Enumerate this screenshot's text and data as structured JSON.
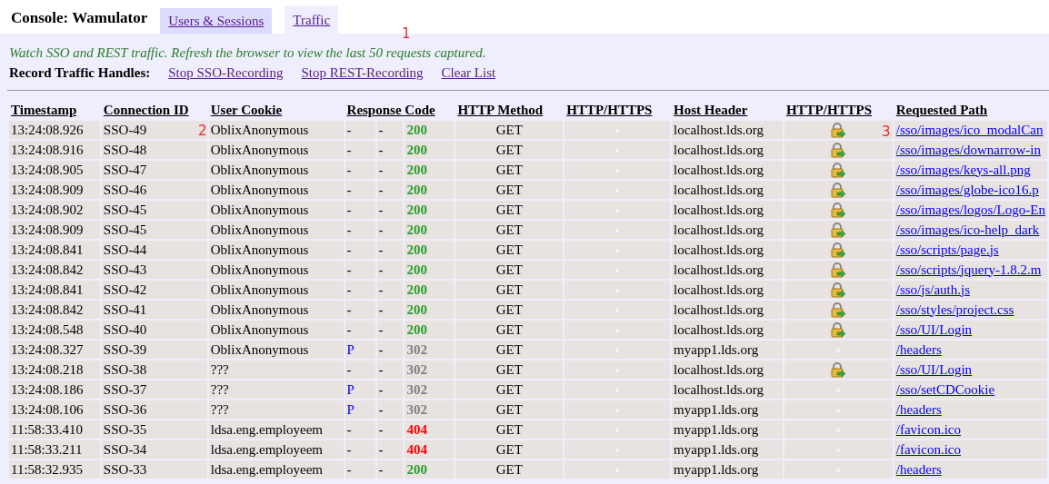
{
  "header": {
    "title": "Console: Wamulator",
    "tabs": [
      {
        "label": "Users & Sessions",
        "selected": false
      },
      {
        "label": "Traffic",
        "selected": true
      }
    ]
  },
  "intro": "Watch SSO and REST traffic. Refresh the browser to view the last 50 requests captured.",
  "record": {
    "label": "Record Traffic Handles:",
    "links": [
      "Stop SSO-Recording",
      "Stop REST-Recording",
      "Clear List"
    ]
  },
  "markers": [
    "1",
    "2",
    "3"
  ],
  "table": {
    "columns": [
      "Timestamp",
      "Connection ID",
      "User Cookie",
      "Response Code",
      "HTTP Method",
      "HTTP/HTTPS",
      "Host Header",
      "HTTP/HTTPS",
      "Requested Path"
    ],
    "rows": [
      {
        "timestamp": "13:24:08.926",
        "connection": "SSO-49",
        "cookie": "OblixAnonymous",
        "flag": "-",
        "flag_highlighted": false,
        "flag2": "-",
        "code": "200",
        "method": "GET",
        "host": "localhost.lds.org",
        "secure": true,
        "path": "/sso/images/ico_modalCan"
      },
      {
        "timestamp": "13:24:08.916",
        "connection": "SSO-48",
        "cookie": "OblixAnonymous",
        "flag": "-",
        "flag_highlighted": false,
        "flag2": "-",
        "code": "200",
        "method": "GET",
        "host": "localhost.lds.org",
        "secure": true,
        "path": "/sso/images/downarrow-in"
      },
      {
        "timestamp": "13:24:08.905",
        "connection": "SSO-47",
        "cookie": "OblixAnonymous",
        "flag": "-",
        "flag_highlighted": false,
        "flag2": "-",
        "code": "200",
        "method": "GET",
        "host": "localhost.lds.org",
        "secure": true,
        "path": "/sso/images/keys-all.png"
      },
      {
        "timestamp": "13:24:08.909",
        "connection": "SSO-46",
        "cookie": "OblixAnonymous",
        "flag": "-",
        "flag_highlighted": false,
        "flag2": "-",
        "code": "200",
        "method": "GET",
        "host": "localhost.lds.org",
        "secure": true,
        "path": "/sso/images/globe-ico16.p"
      },
      {
        "timestamp": "13:24:08.902",
        "connection": "SSO-45",
        "cookie": "OblixAnonymous",
        "flag": "-",
        "flag_highlighted": false,
        "flag2": "-",
        "code": "200",
        "method": "GET",
        "host": "localhost.lds.org",
        "secure": true,
        "path": "/sso/images/logos/Logo-En"
      },
      {
        "timestamp": "13:24:08.909",
        "connection": "SSO-45",
        "cookie": "OblixAnonymous",
        "flag": "-",
        "flag_highlighted": false,
        "flag2": "-",
        "code": "200",
        "method": "GET",
        "host": "localhost.lds.org",
        "secure": true,
        "path": "/sso/images/ico-help_dark"
      },
      {
        "timestamp": "13:24:08.841",
        "connection": "SSO-44",
        "cookie": "OblixAnonymous",
        "flag": "-",
        "flag_highlighted": false,
        "flag2": "-",
        "code": "200",
        "method": "GET",
        "host": "localhost.lds.org",
        "secure": true,
        "path": "/sso/scripts/page.js"
      },
      {
        "timestamp": "13:24:08.842",
        "connection": "SSO-43",
        "cookie": "OblixAnonymous",
        "flag": "-",
        "flag_highlighted": false,
        "flag2": "-",
        "code": "200",
        "method": "GET",
        "host": "localhost.lds.org",
        "secure": true,
        "path": "/sso/scripts/jquery-1.8.2.m"
      },
      {
        "timestamp": "13:24:08.841",
        "connection": "SSO-42",
        "cookie": "OblixAnonymous",
        "flag": "-",
        "flag_highlighted": false,
        "flag2": "-",
        "code": "200",
        "method": "GET",
        "host": "localhost.lds.org",
        "secure": true,
        "path": "/sso/js/auth.js"
      },
      {
        "timestamp": "13:24:08.842",
        "connection": "SSO-41",
        "cookie": "OblixAnonymous",
        "flag": "-",
        "flag_highlighted": false,
        "flag2": "-",
        "code": "200",
        "method": "GET",
        "host": "localhost.lds.org",
        "secure": true,
        "path": "/sso/styles/project.css"
      },
      {
        "timestamp": "13:24:08.548",
        "connection": "SSO-40",
        "cookie": "OblixAnonymous",
        "flag": "-",
        "flag_highlighted": false,
        "flag2": "-",
        "code": "200",
        "method": "GET",
        "host": "localhost.lds.org",
        "secure": true,
        "path": "/sso/UI/Login"
      },
      {
        "timestamp": "13:24:08.327",
        "connection": "SSO-39",
        "cookie": "OblixAnonymous",
        "flag": "P",
        "flag_highlighted": true,
        "flag2": "-",
        "code": "302",
        "method": "GET",
        "host": "myapp1.lds.org",
        "secure": false,
        "path": "/headers"
      },
      {
        "timestamp": "13:24:08.218",
        "connection": "SSO-38",
        "cookie": "???",
        "flag": "-",
        "flag_highlighted": false,
        "flag2": "-",
        "code": "302",
        "method": "GET",
        "host": "localhost.lds.org",
        "secure": true,
        "path": "/sso/UI/Login"
      },
      {
        "timestamp": "13:24:08.186",
        "connection": "SSO-37",
        "cookie": "???",
        "flag": "P",
        "flag_highlighted": true,
        "flag2": "-",
        "code": "302",
        "method": "GET",
        "host": "localhost.lds.org",
        "secure": false,
        "path": "/sso/setCDCookie"
      },
      {
        "timestamp": "13:24:08.106",
        "connection": "SSO-36",
        "cookie": "???",
        "flag": "P",
        "flag_highlighted": true,
        "flag2": "-",
        "code": "302",
        "method": "GET",
        "host": "myapp1.lds.org",
        "secure": false,
        "path": "/headers"
      },
      {
        "timestamp": "11:58:33.410",
        "connection": "SSO-35",
        "cookie": "ldsa.eng.employeem",
        "flag": "-",
        "flag_highlighted": false,
        "flag2": "-",
        "code": "404",
        "method": "GET",
        "host": "myapp1.lds.org",
        "secure": false,
        "path": "/favicon.ico"
      },
      {
        "timestamp": "11:58:33.211",
        "connection": "SSO-34",
        "cookie": "ldsa.eng.employeem",
        "flag": "-",
        "flag_highlighted": false,
        "flag2": "-",
        "code": "404",
        "method": "GET",
        "host": "myapp1.lds.org",
        "secure": false,
        "path": "/favicon.ico"
      },
      {
        "timestamp": "11:58:32.935",
        "connection": "SSO-33",
        "cookie": "ldsa.eng.employeem",
        "flag": "-",
        "flag_highlighted": false,
        "flag2": "-",
        "code": "200",
        "method": "GET",
        "host": "myapp1.lds.org",
        "secure": false,
        "path": "/headers"
      }
    ]
  }
}
